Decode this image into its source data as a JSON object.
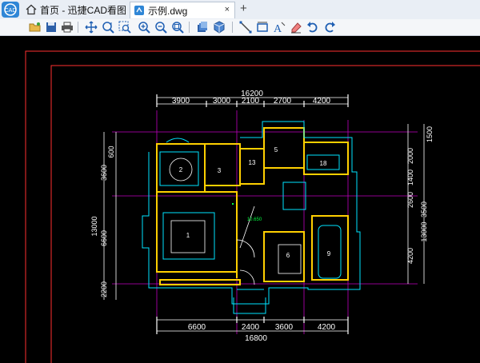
{
  "tabs": {
    "home_label": "首页 - 迅捷CAD看图",
    "file_label": "示例.dwg",
    "close_glyph": "×",
    "add_glyph": "+"
  },
  "drawing": {
    "dims_top": [
      "16200",
      "3900",
      "3000",
      "2100",
      "2700",
      "4200"
    ],
    "dims_bottom": [
      "6600",
      "2400",
      "3600",
      "4200",
      "16800"
    ],
    "dims_left": [
      "600",
      "3600",
      "13000",
      "6600",
      "2200"
    ],
    "dims_right": [
      "1500",
      "2000",
      "1400",
      "2600",
      "3500",
      "13000",
      "4200"
    ],
    "room_labels": [
      "2",
      "3",
      "13",
      "5",
      "18",
      "1",
      "6",
      "9"
    ],
    "annotation": "10.650"
  },
  "colors": {
    "cad_background": "#000000",
    "dimension_white": "#ffffff",
    "wall_yellow": "#ffd000",
    "border_red": "#ff3030",
    "grid_magenta": "#ff00ff",
    "outline_cyan": "#00e5ff"
  }
}
